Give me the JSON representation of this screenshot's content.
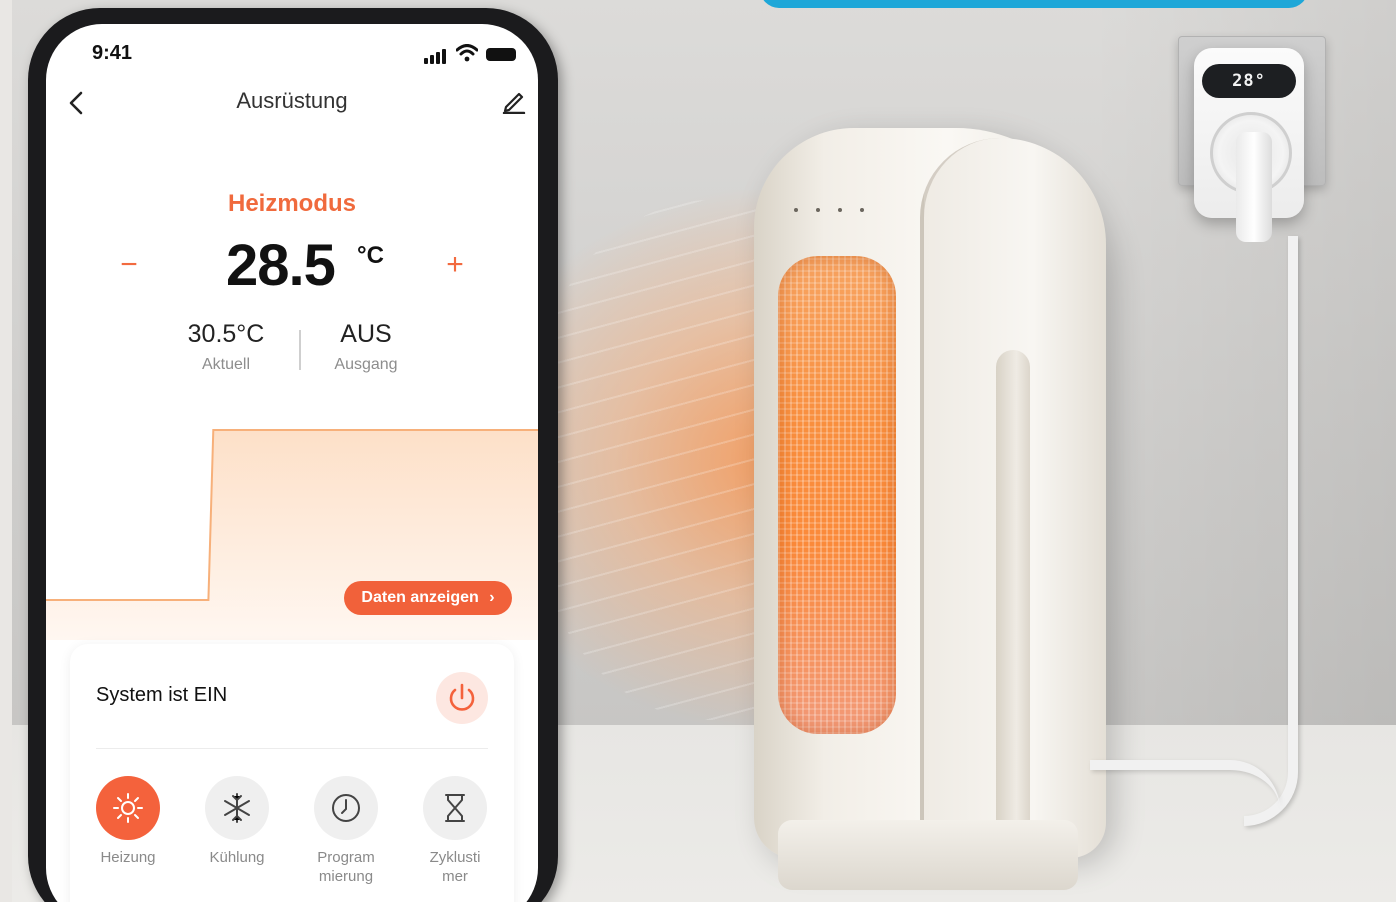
{
  "background": {
    "thermostat_display": "28°"
  },
  "status_bar": {
    "time": "9:41"
  },
  "nav": {
    "title": "Ausrüstung"
  },
  "thermostat": {
    "mode_label": "Heizmodus",
    "minus_label": "−",
    "plus_label": "+",
    "setpoint": "28.5",
    "setpoint_unit": "°C",
    "current_value": "30.5°C",
    "current_label": "Aktuell",
    "output_value": "AUS",
    "output_label": "Ausgang"
  },
  "chart_data": {
    "type": "area",
    "x": [
      0,
      0.33,
      0.34,
      1
    ],
    "values": [
      0,
      0,
      1,
      1
    ],
    "fill_color": "#fde6d3",
    "line_color": "#f7b07a"
  },
  "data_button": {
    "label": "Daten anzeigen",
    "chevron": "›"
  },
  "system": {
    "label": "System ist EIN",
    "power_icon": "power-icon"
  },
  "modes": [
    {
      "label": "Heizung",
      "icon": "sun-icon",
      "active": true
    },
    {
      "label": "Kühlung",
      "icon": "snowflake-icon",
      "active": false
    },
    {
      "label": "Program\nmierung",
      "icon": "clock-icon",
      "active": false
    },
    {
      "label": "Zyklusti\nmer",
      "icon": "hourglass-icon",
      "active": false
    }
  ],
  "colors": {
    "accent": "#f4623c",
    "accent_light": "#fde7e1"
  }
}
